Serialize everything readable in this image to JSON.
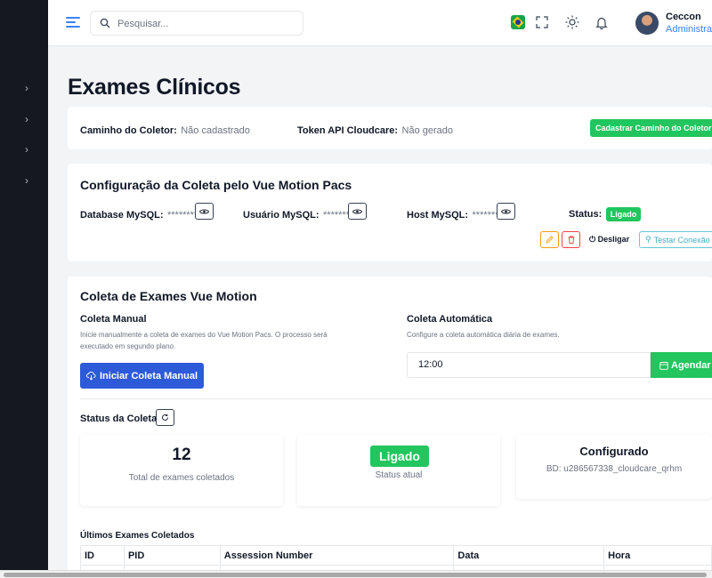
{
  "search": {
    "placeholder": "Pesquisar..."
  },
  "user": {
    "name": "Ceccon",
    "role": "Administrador"
  },
  "page": {
    "title": "Exames Clínicos"
  },
  "coletor": {
    "path_label": "Caminho do Coletor:",
    "path_value": "Não cadastrado",
    "token_label": "Token API Cloudcare:",
    "token_value": "Não gerado",
    "register_button": "Cadastrar Caminho do Coletor"
  },
  "config": {
    "title": "Configuração da Coleta pelo Vue Motion Pacs",
    "db_label": "Database MySQL:",
    "db_value": "********",
    "user_label": "Usuário MySQL:",
    "user_value": "********",
    "host_label": "Host MySQL:",
    "host_value": "********",
    "status_label": "Status:",
    "status_value": "Ligado",
    "off_button": "Desligar",
    "test_button": "Testar Conexão"
  },
  "coleta": {
    "title": "Coleta de Exames Vue Motion",
    "manual_title": "Coleta Manual",
    "manual_desc_1": "Inicie manualmente a coleta de exames do Vue Motion Pacs. O processo será",
    "manual_desc_2": "executado em segundo plano.",
    "manual_button": "Iniciar Coleta Manual",
    "auto_title": "Coleta Automática",
    "auto_desc": "Configure a coleta automática diária de exames.",
    "time_value": "12:00",
    "schedule_button": "Agendar"
  },
  "status": {
    "title": "Status da Coleta",
    "total_value": "12",
    "total_label": "Total de exames coletados",
    "state_value": "Ligado",
    "state_label": "Status atual",
    "config_value": "Configurado",
    "config_db": "BD: u286567338_cloudcare_qrhm"
  },
  "table": {
    "title": "Últimos Exames Coletados",
    "columns": [
      "ID",
      "PID",
      "Assession Number",
      "Data",
      "Hora"
    ]
  },
  "colors": {
    "green": "#22c55e",
    "blue": "#2d5ad8",
    "sidebar": "#15181e"
  }
}
